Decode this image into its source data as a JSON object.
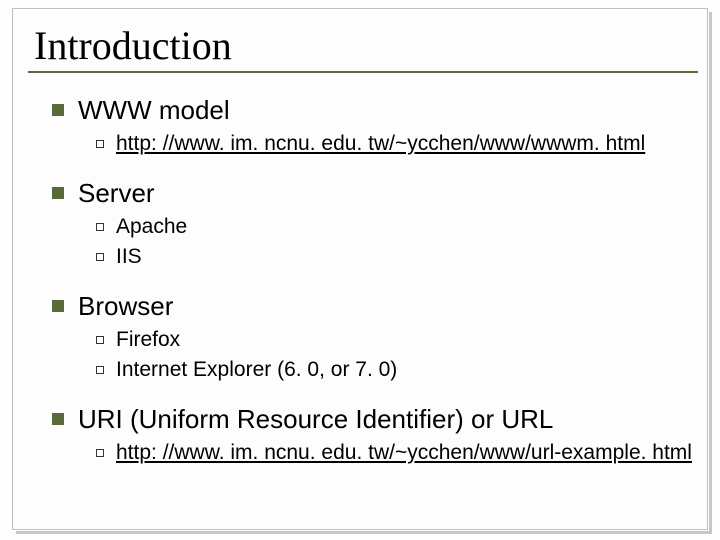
{
  "title": "Introduction",
  "items": {
    "www": {
      "label": "WWW model",
      "link": "http: //www. im. ncnu. edu. tw/~ycchen/www/wwwm. html"
    },
    "server": {
      "label": "Server",
      "sub1": "Apache",
      "sub2": "IIS"
    },
    "browser": {
      "label": "Browser",
      "sub1": "Firefox",
      "sub2": "Internet Explorer (6. 0, or 7. 0)"
    },
    "uri": {
      "label": "URI (Uniform Resource Identifier) or URL",
      "link": "http: //www. im. ncnu. edu. tw/~ycchen/www/url-example. html"
    }
  }
}
